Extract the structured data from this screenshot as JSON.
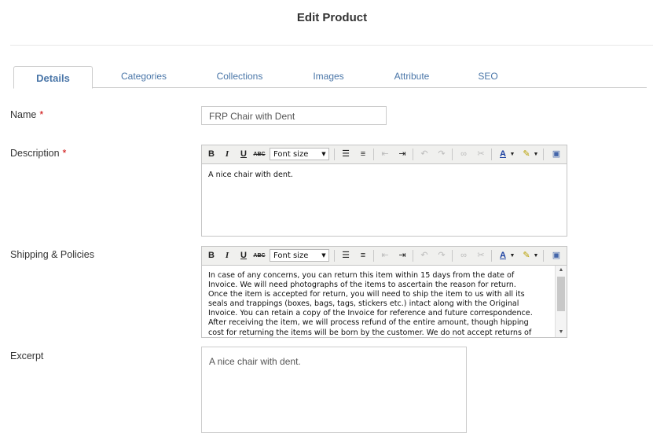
{
  "page": {
    "title": "Edit Product"
  },
  "tabs": [
    "Details",
    "Categories",
    "Collections",
    "Images",
    "Attribute",
    "SEO"
  ],
  "fields": {
    "name_label": "Name",
    "name_value": "FRP Chair with Dent",
    "description_label": "Description",
    "description_value": "A nice chair with dent.",
    "shipping_label": "Shipping & Policies",
    "shipping_lines": [
      "In case of any concerns, you can return this item within 15 days from the date of",
      "Invoice. We will need photographs of the items to ascertain the reason for return.",
      "Once the item is accepted for return, you will need to ship the item to us with all its",
      "seals and trappings (boxes, bags, tags, stickers etc.) intact along with the Original",
      "Invoice. You can retain a copy of the Invoice for reference and future correspondence.",
      "After receiving the item, we will process refund of the entire amount, though hipping",
      "cost for returning the items will be born by the customer. We do not accept returns of"
    ],
    "excerpt_label": "Excerpt",
    "excerpt_value": "A nice chair with dent.",
    "required_marker": "*"
  },
  "editor_toolbar": {
    "bold": "B",
    "italic": "I",
    "underline": "U",
    "strike": "ABC",
    "font_size": "Font size"
  }
}
